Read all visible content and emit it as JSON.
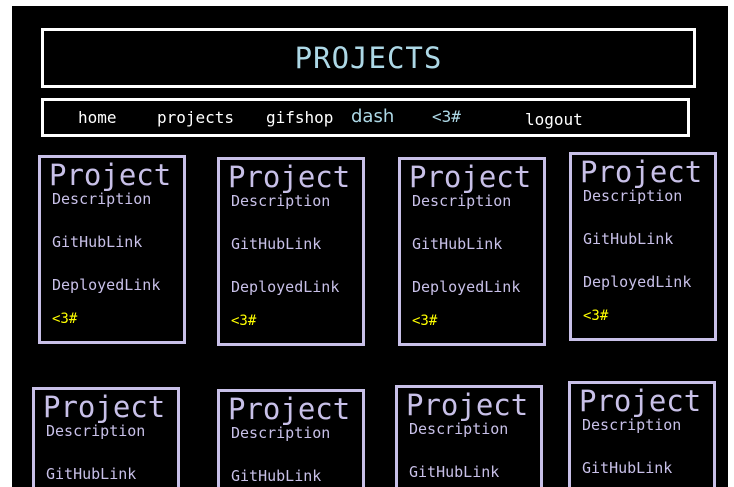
{
  "header": {
    "title": "PROJECTS"
  },
  "nav": {
    "items": [
      {
        "label": "home"
      },
      {
        "label": "projects"
      },
      {
        "label": "gifshop"
      },
      {
        "label": "dash"
      },
      {
        "label": "<3#"
      },
      {
        "label": "logout"
      }
    ]
  },
  "cards": [
    {
      "title": "Project",
      "description": "Description",
      "github": "GitHubLink",
      "deployed": "DeployedLink",
      "heart": "<3#"
    },
    {
      "title": "Project",
      "description": "Description",
      "github": "GitHubLink",
      "deployed": "DeployedLink",
      "heart": "<3#"
    },
    {
      "title": "Project",
      "description": "Description",
      "github": "GitHubLink",
      "deployed": "DeployedLink",
      "heart": "<3#"
    },
    {
      "title": "Project",
      "description": "Description",
      "github": "GitHubLink",
      "deployed": "DeployedLink",
      "heart": "<3#"
    },
    {
      "title": "Project",
      "description": "Description",
      "github": "GitHubLink"
    },
    {
      "title": "Project",
      "description": "Description",
      "github": "GitHubLink"
    },
    {
      "title": "Project",
      "description": "Description",
      "github": "GitHubLink"
    },
    {
      "title": "Project",
      "description": "Description",
      "github": "GitHubLink"
    }
  ],
  "colors": {
    "background": "#000000",
    "title_text": "#add8e6",
    "frame_border": "#ffffff",
    "card_border": "#c8c0e8",
    "card_text": "#c8c0e8",
    "heart_link": "#ffff00"
  }
}
